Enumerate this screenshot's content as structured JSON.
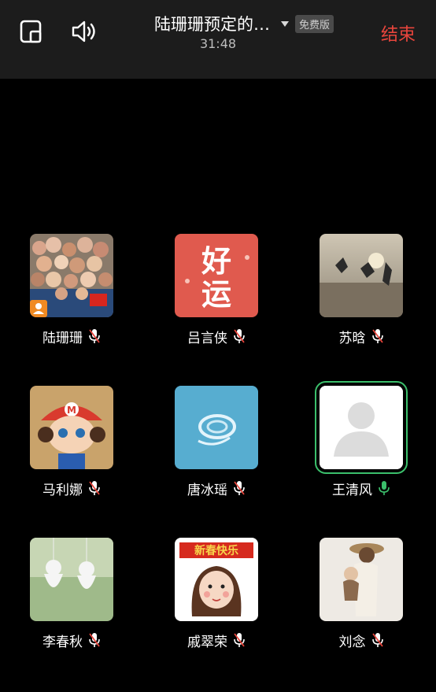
{
  "header": {
    "title": "陆珊珊预定的…",
    "badge": "免费版",
    "timer": "31:48",
    "end_label": "结束"
  },
  "participants": [
    {
      "name": "陆珊珊",
      "mic": "muted",
      "avatar": "flowers-photo"
    },
    {
      "name": "吕言侠",
      "mic": "muted",
      "avatar": "good-luck-card",
      "avatar_text": "好运"
    },
    {
      "name": "苏晗",
      "mic": "muted",
      "avatar": "beach-jump-photo"
    },
    {
      "name": "马利娜",
      "mic": "muted",
      "avatar": "cartoon-mario-girl"
    },
    {
      "name": "唐冰瑶",
      "mic": "muted",
      "avatar": "water-ripple-photo"
    },
    {
      "name": "王清风",
      "mic": "active",
      "avatar": "default-avatar"
    },
    {
      "name": "李春秋",
      "mic": "muted",
      "avatar": "teru-teru-bozu-photo"
    },
    {
      "name": "戚翠荣",
      "mic": "muted",
      "avatar": "cartoon-girl-new-year",
      "avatar_text": "新春快乐"
    },
    {
      "name": "刘念",
      "mic": "muted",
      "avatar": "mother-child-photo"
    }
  ],
  "colors": {
    "end": "#e8453c",
    "active_mic": "#3bbf6b",
    "background": "#000000"
  }
}
